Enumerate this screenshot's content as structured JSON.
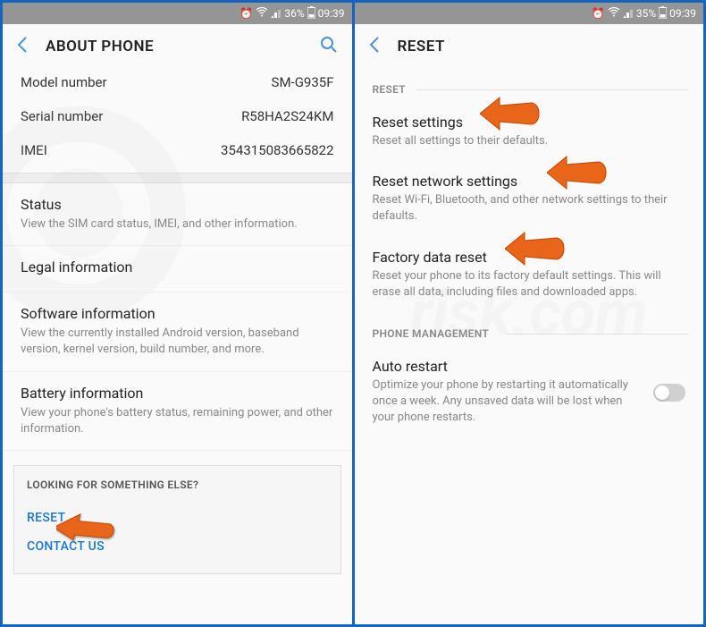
{
  "left_panel": {
    "status": {
      "battery": "36%",
      "time": "09:39"
    },
    "header": {
      "title": "ABOUT PHONE"
    },
    "info": [
      {
        "label": "Model number",
        "value": "SM-G935F"
      },
      {
        "label": "Serial number",
        "value": "R58HA2S24KM"
      },
      {
        "label": "IMEI",
        "value": "354315083665822"
      }
    ],
    "items": [
      {
        "title": "Status",
        "desc": "View the SIM card status, IMEI, and other information."
      },
      {
        "title": "Legal information",
        "desc": ""
      },
      {
        "title": "Software information",
        "desc": "View the currently installed Android version, baseband version, kernel version, build number, and more."
      },
      {
        "title": "Battery information",
        "desc": "View your phone's battery status, remaining power, and other information."
      }
    ],
    "footer": {
      "heading": "LOOKING FOR SOMETHING ELSE?",
      "links": [
        "RESET",
        "CONTACT US"
      ]
    }
  },
  "right_panel": {
    "status": {
      "battery": "35%",
      "time": "09:39"
    },
    "header": {
      "title": "RESET"
    },
    "section1": "RESET",
    "reset_items": [
      {
        "title": "Reset settings",
        "desc": "Reset all settings to their defaults."
      },
      {
        "title": "Reset network settings",
        "desc": "Reset Wi-Fi, Bluetooth, and other network settings to their defaults."
      },
      {
        "title": "Factory data reset",
        "desc": "Reset your phone to its factory default settings. This will erase all data, including files and downloaded apps."
      }
    ],
    "section2": "PHONE MANAGEMENT",
    "mgmt_items": [
      {
        "title": "Auto restart",
        "desc": "Optimize your phone by restarting it automatically once a week. Any unsaved data will be lost when your phone restarts."
      }
    ]
  }
}
